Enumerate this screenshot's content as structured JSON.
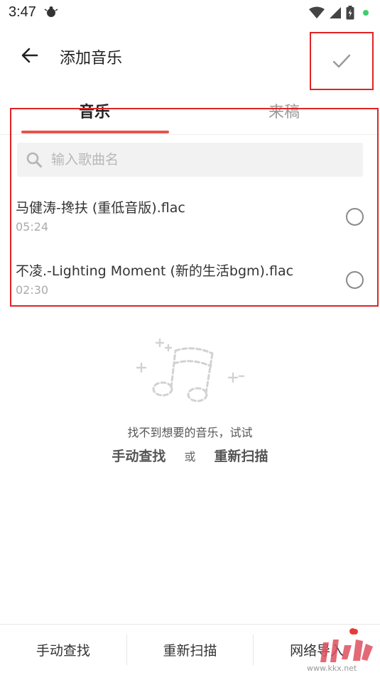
{
  "status_bar": {
    "time": "3:47",
    "app_icon": "bug-icon",
    "icons": [
      "wifi-icon",
      "signal-icon",
      "battery-icon",
      "notification-dot"
    ]
  },
  "header": {
    "title": "添加音乐",
    "back_icon": "arrow-left-icon",
    "confirm_icon": "check-icon"
  },
  "tabs": [
    {
      "label": "音乐",
      "active": true
    },
    {
      "label": "来稿",
      "active": false
    }
  ],
  "search": {
    "placeholder": "输入歌曲名",
    "value": ""
  },
  "songs": [
    {
      "title": "马健涛-搀扶 (重低音版).flac",
      "duration": "05:24",
      "selected": false
    },
    {
      "title": "不凌.-Lighting Moment (新的生活bgm).flac",
      "duration": "02:30",
      "selected": false
    }
  ],
  "empty_state": {
    "illustration": "music-note-icon",
    "hint": "找不到想要的音乐，试试",
    "action_manual": "手动查找",
    "or": "或",
    "action_rescan": "重新扫描"
  },
  "bottom_bar": {
    "items": [
      "手动查找",
      "重新扫描",
      "网络导入"
    ]
  },
  "watermark": {
    "text": "www.kkx.net"
  },
  "colors": {
    "accent": "#e8534f",
    "highlight_box": "#e02424",
    "status_dot": "#3ccf6b"
  }
}
